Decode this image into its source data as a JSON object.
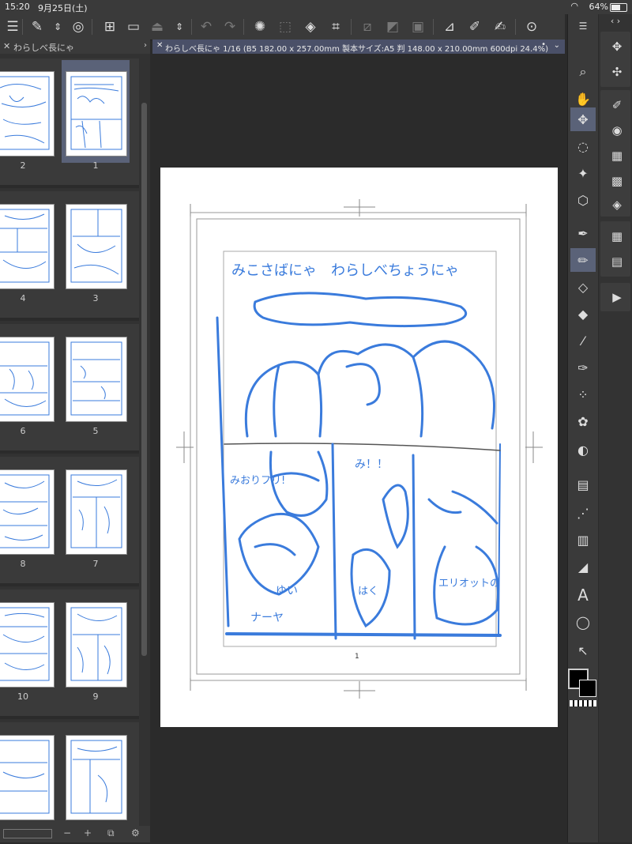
{
  "status_bar": {
    "time": "15:20",
    "date": "9月25日(土)",
    "battery": "64%"
  },
  "pages_panel": {
    "tab_label": "わらしべ長にゃ",
    "pages": [
      {
        "number": "2",
        "selected": false
      },
      {
        "number": "1",
        "selected": true
      },
      {
        "number": "4",
        "selected": false
      },
      {
        "number": "3",
        "selected": false
      },
      {
        "number": "6",
        "selected": false
      },
      {
        "number": "5",
        "selected": false
      },
      {
        "number": "8",
        "selected": false
      },
      {
        "number": "7",
        "selected": false
      },
      {
        "number": "10",
        "selected": false
      },
      {
        "number": "9",
        "selected": false
      }
    ],
    "bottom": {
      "minus": "−",
      "plus": "+"
    }
  },
  "canvas": {
    "tab_title": "わらしべ長にゃ 1/16 (B5 182.00 x 257.00mm 製本サイズ:A5 判 148.00 x 210.00mm 600dpi 24.4%)",
    "page_number": "1",
    "sketch_text": {
      "header": "みこさばにゃ　わらしべちょうにゃ",
      "speech1": "み！！",
      "speech2": "みおりフリ!",
      "speech3": "ゆい",
      "speech4": "はく",
      "speech5": "エリオットの",
      "speech6": "ナーヤ"
    }
  },
  "colors": {
    "accent": "#5a6278",
    "sketch_blue": "#3a7bdc",
    "panel_bg": "#323232"
  }
}
